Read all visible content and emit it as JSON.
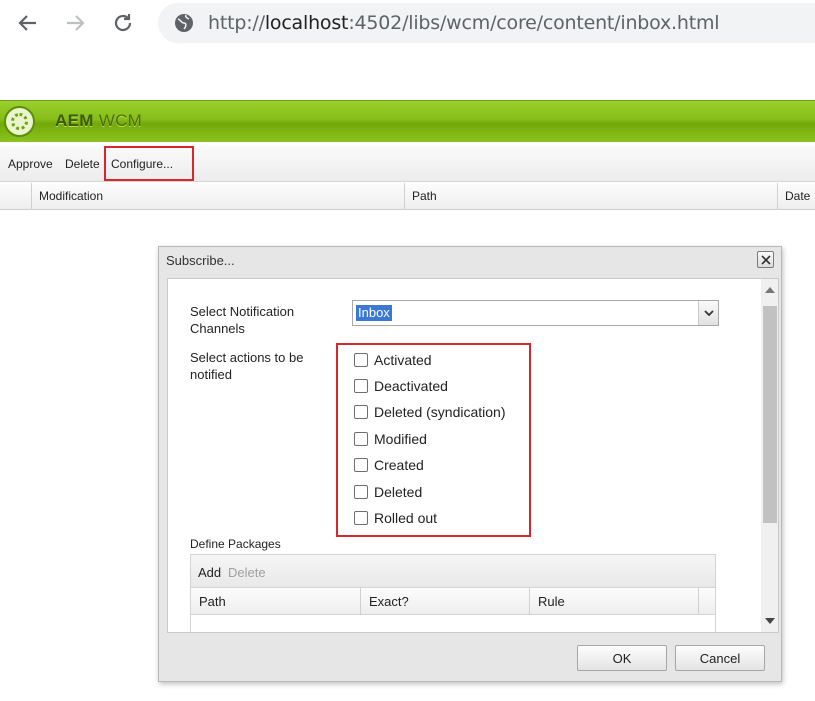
{
  "browser": {
    "url_prefix": "http://",
    "url_host": "localhost",
    "url_rest": ":4502/libs/wcm/core/content/inbox.html"
  },
  "header": {
    "title_bold": "AEM",
    "title_light": "WCM",
    "brand_color": "#86bd18"
  },
  "toolbar": {
    "approve": "Approve",
    "delete": "Delete",
    "configure": "Configure..."
  },
  "grid": {
    "columns": [
      "Modification",
      "Path",
      "Date"
    ]
  },
  "dialog": {
    "title": "Subscribe...",
    "channels_label": "Select Notification Channels",
    "channels_value": "Inbox",
    "actions_label": "Select actions to be notified",
    "actions": [
      {
        "label": "Activated",
        "checked": false
      },
      {
        "label": "Deactivated",
        "checked": false
      },
      {
        "label": "Deleted (syndication)",
        "checked": false
      },
      {
        "label": "Modified",
        "checked": false
      },
      {
        "label": "Created",
        "checked": false
      },
      {
        "label": "Deleted",
        "checked": false
      },
      {
        "label": "Rolled out",
        "checked": false
      }
    ],
    "packages": {
      "label": "Define Packages",
      "add": "Add",
      "delete": "Delete",
      "columns": [
        "Path",
        "Exact?",
        "Rule"
      ]
    },
    "ok": "OK",
    "cancel": "Cancel"
  },
  "colors": {
    "highlight": "#d9262c",
    "selection": "#3a78d4"
  }
}
